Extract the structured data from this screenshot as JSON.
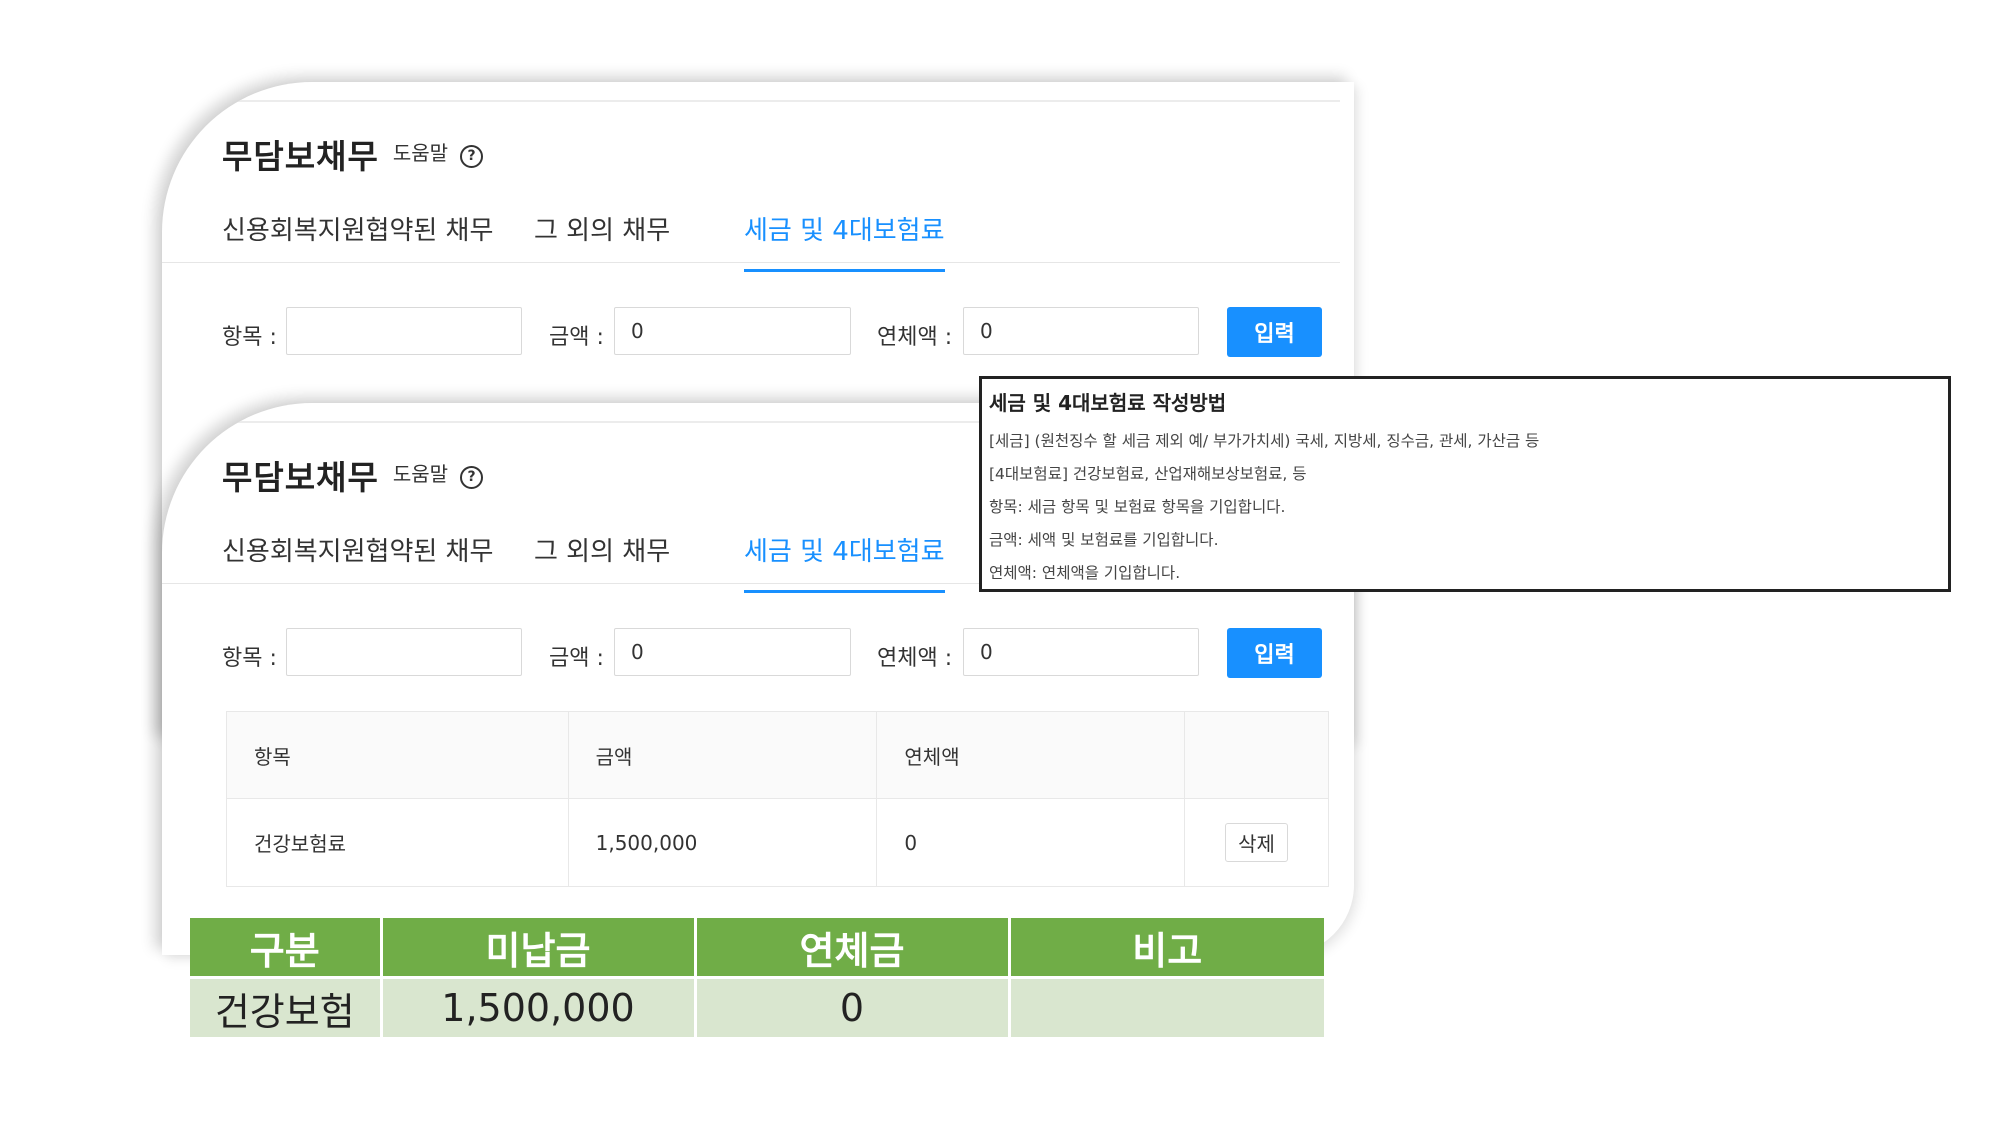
{
  "panel_back": {
    "title": "무담보채무",
    "help_label": "도움말",
    "help_icon": "?",
    "tabs": [
      "신용회복지원협약된 채무",
      "그 외의 채무",
      "세금 및 4대보험료"
    ],
    "form": {
      "item_label": "항목 :",
      "item_value": "",
      "amount_label": "금액 :",
      "amount_value": "0",
      "overdue_label": "연체액 :",
      "overdue_value": "0",
      "submit_label": "입력"
    }
  },
  "panel_front": {
    "title": "무담보채무",
    "help_label": "도움말",
    "help_icon": "?",
    "tabs": [
      "신용회복지원협약된 채무",
      "그 외의 채무",
      "세금 및 4대보험료"
    ],
    "form": {
      "item_label": "항목 :",
      "item_value": "",
      "amount_label": "금액 :",
      "amount_value": "0",
      "overdue_label": "연체액 :",
      "overdue_value": "0",
      "submit_label": "입력"
    },
    "table": {
      "headers": [
        "항목",
        "금액",
        "연체액",
        ""
      ],
      "rows": [
        {
          "item": "건강보험료",
          "amount": "1,500,000",
          "overdue": "0",
          "action": "삭제"
        }
      ]
    }
  },
  "tooltip": {
    "title": "세금 및 4대보험료 작성방법",
    "lines": [
      "[세금] (원천징수 할 세금 제외 예/ 부가가치세) 국세, 지방세, 징수금, 관세, 가산금 등",
      "[4대보험료] 건강보험료, 산업재해보상보험료, 등",
      "항목: 세금 항목 및 보험료 항목을 기입합니다.",
      "금액: 세액 및 보험료를 기입합니다.",
      "연체액: 연체액을 기입합니다."
    ]
  },
  "summary": {
    "headers": [
      "구분",
      "미납금",
      "연체금",
      "비고"
    ],
    "row": [
      "건강보험",
      "1,500,000",
      "0",
      ""
    ]
  },
  "colors": {
    "accent": "#1890ff",
    "summary_header": "#70ad47",
    "summary_row": "#d9e6cf"
  }
}
